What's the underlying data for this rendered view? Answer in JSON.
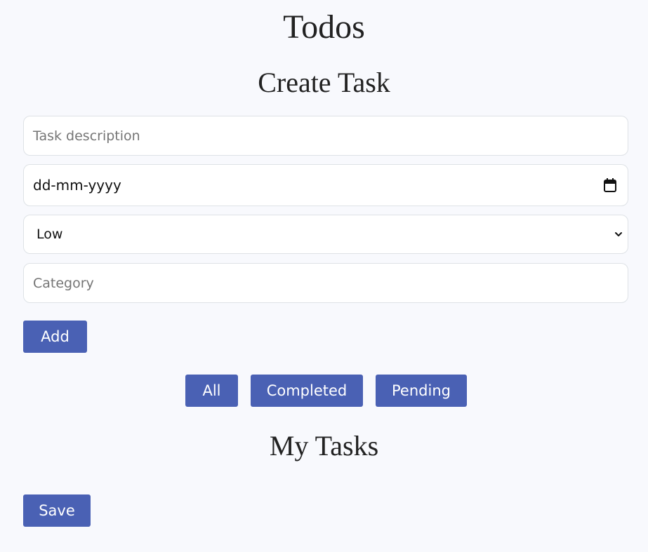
{
  "app": {
    "title": "Todos"
  },
  "create_task": {
    "heading": "Create Task",
    "description_placeholder": "Task description",
    "date_placeholder": "dd-mm-yyyy",
    "priority_selected": "Low",
    "category_placeholder": "Category",
    "add_label": "Add"
  },
  "filters": [
    {
      "label": "All"
    },
    {
      "label": "Completed"
    },
    {
      "label": "Pending"
    }
  ],
  "my_tasks": {
    "heading": "My Tasks",
    "save_label": "Save"
  },
  "colors": {
    "accent": "#4a61b4",
    "background": "#f8f9fd",
    "field_border": "#dee2e6"
  },
  "icons": {
    "date": "calendar-icon",
    "select": "chevron-down-icon"
  }
}
